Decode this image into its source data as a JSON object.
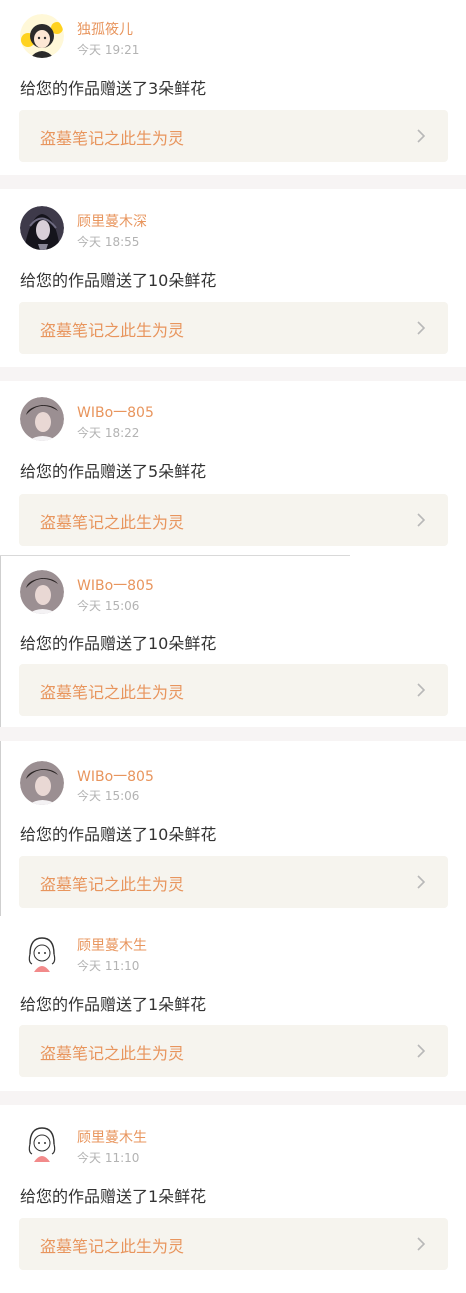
{
  "colors": {
    "accent": "#e8955d",
    "time": "#b3b3b3",
    "text": "#333333",
    "link_bg": "#f6f4ee",
    "separator": "#f7f4f4"
  },
  "notifications": [
    {
      "name": "独孤筱儿",
      "time": "今天 19:21",
      "message": "给您的作品赠送了3朵鲜花",
      "work_title": "盗墓笔记之此生为灵",
      "avatar": "cartoon-girl-yellow-avatar"
    },
    {
      "name": "顾里蔓木深",
      "time": "今天 18:55",
      "message": "给您的作品赠送了10朵鲜花",
      "work_title": "盗墓笔记之此生为灵",
      "avatar": "dark-anime-character-avatar"
    },
    {
      "name": "WIBo一805",
      "time": "今天 18:22",
      "message": "给您的作品赠送了5朵鲜花",
      "work_title": "盗墓笔记之此生为灵",
      "avatar": "young-man-photo-avatar"
    },
    {
      "name": "WIBo一805",
      "time": "今天 15:06",
      "message": "给您的作品赠送了10朵鲜花",
      "work_title": "盗墓笔记之此生为灵",
      "avatar": "young-man-photo-avatar"
    },
    {
      "name": "WIBo一805",
      "time": "今天 15:06",
      "message": "给您的作品赠送了10朵鲜花",
      "work_title": "盗墓笔记之此生为灵",
      "avatar": "young-man-photo-avatar"
    },
    {
      "name": "顾里蔓木生",
      "time": "今天 11:10",
      "message": "给您的作品赠送了1朵鲜花",
      "work_title": "盗墓笔记之此生为灵",
      "avatar": "sketch-girl-avatar"
    },
    {
      "name": "顾里蔓木生",
      "time": "今天 11:10",
      "message": "给您的作品赠送了1朵鲜花",
      "work_title": "盗墓笔记之此生为灵",
      "avatar": "sketch-girl-avatar"
    }
  ]
}
